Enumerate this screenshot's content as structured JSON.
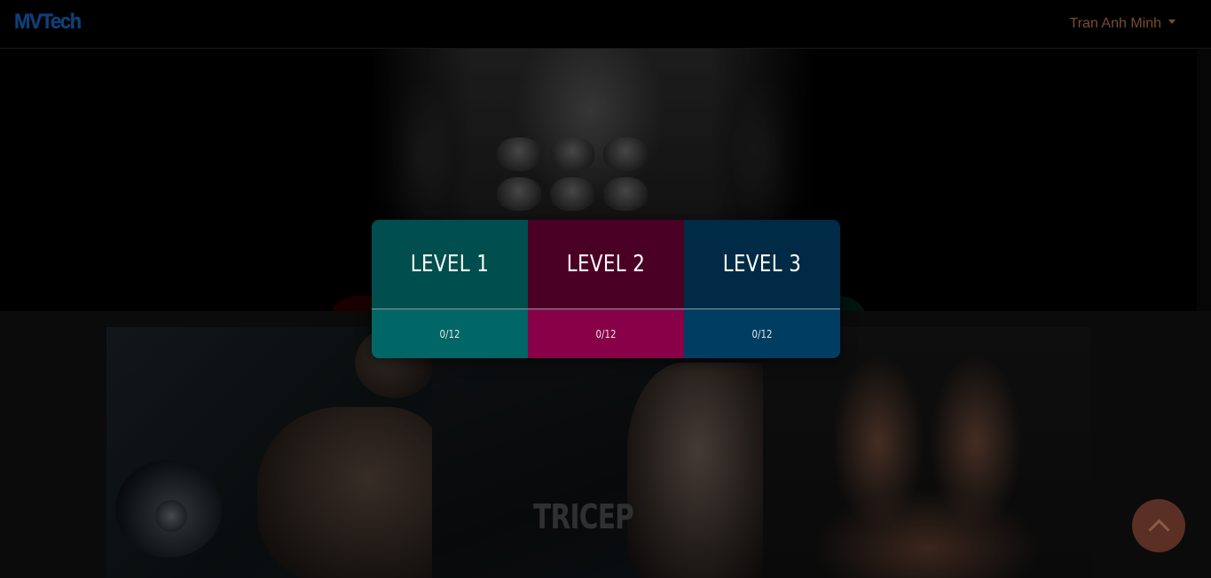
{
  "brand": "MVTech",
  "user": {
    "name": "Tran Anh Minh"
  },
  "categories": [
    {
      "label": ""
    },
    {
      "label": "TRICEP"
    },
    {
      "label": ""
    }
  ],
  "levels": [
    {
      "title": "LEVEL 1",
      "progress": "0/12"
    },
    {
      "title": "LEVEL 2",
      "progress": "0/12"
    },
    {
      "title": "LEVEL 3",
      "progress": "0/12"
    }
  ],
  "colors": {
    "level1": "#004e4d",
    "level1_progress": "#006666",
    "level2": "#4a0024",
    "level2_progress": "#880048",
    "level3": "#002a45",
    "level3_progress": "#003d63",
    "brand": "#0e3f78"
  },
  "icons": {
    "scroll_top": "chevron-up-icon",
    "user_menu": "caret-down-icon"
  }
}
